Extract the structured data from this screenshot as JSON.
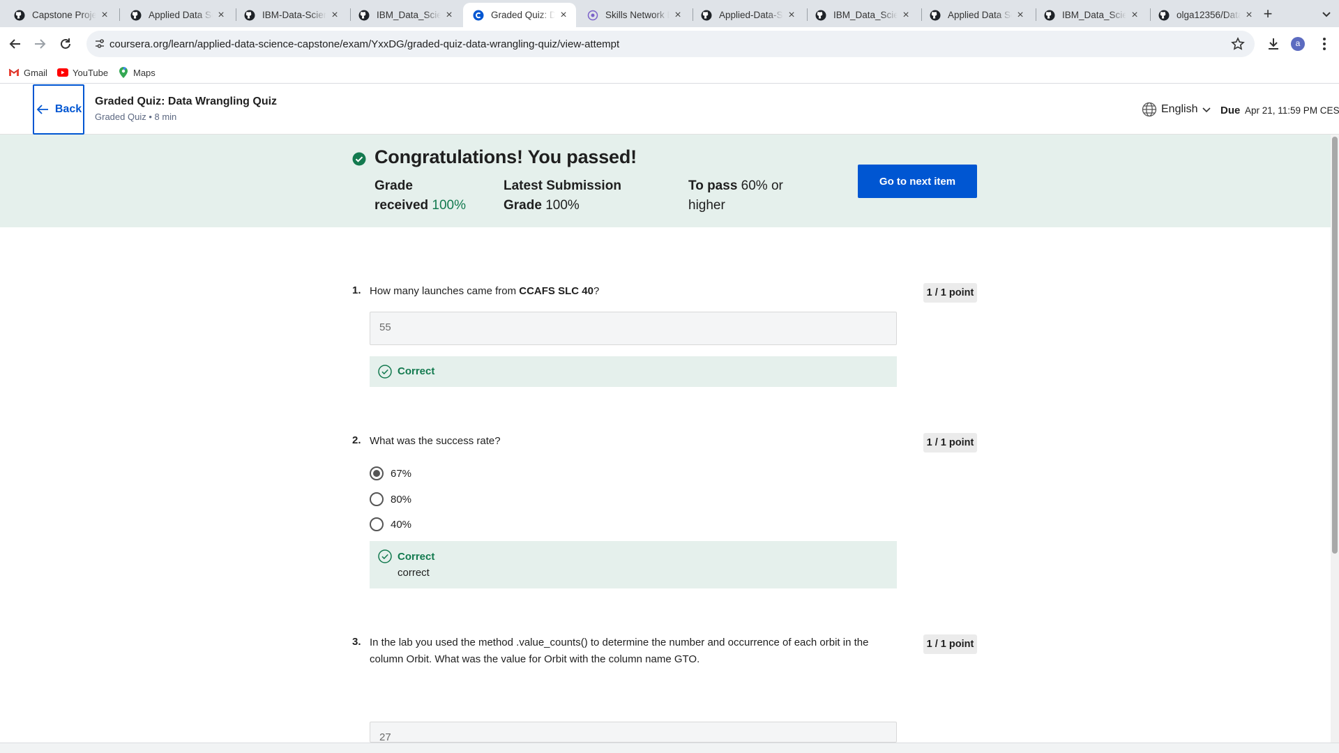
{
  "browser": {
    "tabs": [
      {
        "title": "Capstone Project",
        "icon": "github-icon",
        "active": false
      },
      {
        "title": "Applied Data Science",
        "icon": "github-icon",
        "active": false
      },
      {
        "title": "IBM-Data-Science",
        "icon": "github-icon",
        "active": false
      },
      {
        "title": "IBM_Data_Science",
        "icon": "github-icon",
        "active": false
      },
      {
        "title": "Graded Quiz: Data",
        "icon": "coursera-icon",
        "active": true
      },
      {
        "title": "Skills Network Editor",
        "icon": "skills-network-icon",
        "active": false
      },
      {
        "title": "Applied-Data-Science",
        "icon": "github-icon",
        "active": false
      },
      {
        "title": "IBM_Data_Science",
        "icon": "github-icon",
        "active": false
      },
      {
        "title": "Applied Data Science",
        "icon": "github-icon",
        "active": false
      },
      {
        "title": "IBM_Data_Science",
        "icon": "github-icon",
        "active": false
      },
      {
        "title": "olga12356/Data",
        "icon": "github-icon",
        "active": false
      }
    ],
    "url": "coursera.org/learn/applied-data-science-capstone/exam/YxxDG/graded-quiz-data-wrangling-quiz/view-attempt",
    "profile_initial": "a",
    "bookmarks": [
      {
        "label": "Gmail",
        "icon": "gmail-icon"
      },
      {
        "label": "YouTube",
        "icon": "youtube-icon"
      },
      {
        "label": "Maps",
        "icon": "maps-icon"
      }
    ]
  },
  "header": {
    "back_label": "Back",
    "title": "Graded Quiz: Data Wrangling Quiz",
    "meta": "Graded Quiz • 8 min",
    "language": "English",
    "due_label": "Due",
    "due_date": "Apr 21, 11:59 PM CEST"
  },
  "result": {
    "title": "Congratulations! You passed!",
    "grade_received_label_1": "Grade",
    "grade_received_label_2": "received",
    "grade_received_value": "100%",
    "latest_label_1": "Latest Submission",
    "latest_label_2": "Grade",
    "latest_value": "100%",
    "to_pass_label": "To pass",
    "to_pass_value_1": "60% or",
    "to_pass_value_2": "higher",
    "next_button": "Go to next item"
  },
  "questions": [
    {
      "number": "1.",
      "text_before": "How many launches came from ",
      "text_bold": "CCAFS SLC 40",
      "text_after": "?",
      "points": "1 / 1 point",
      "answer": "55",
      "feedback": "Correct"
    },
    {
      "number": "2.",
      "text": "What was the success rate?",
      "points": "1 / 1 point",
      "options": [
        "67%",
        "80%",
        "40%"
      ],
      "selected": "67%",
      "feedback": "Correct",
      "feedback_note": "correct"
    },
    {
      "number": "3.",
      "text_line_1": "In the lab you used the method .value_counts() to determine the number and occurrence of each orbit in the",
      "text_line_2": "column Orbit. What was the value for Orbit with the column name GTO.",
      "points": "1 / 1 point",
      "answer": "27"
    }
  ],
  "colors": {
    "brand_blue": "#0056d2",
    "success_green": "#137a4f",
    "banner_bg": "#e5f0ec"
  }
}
